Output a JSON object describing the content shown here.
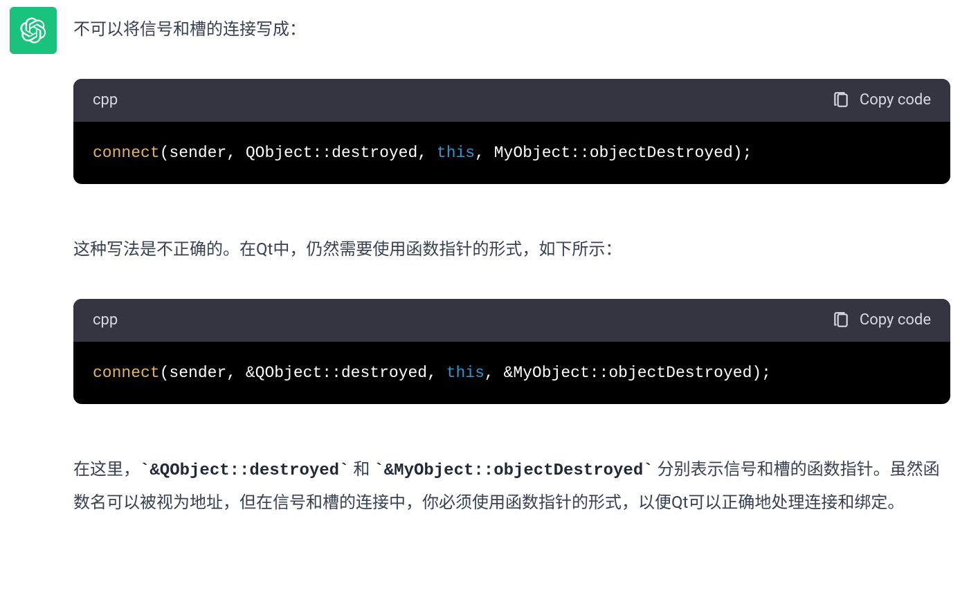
{
  "intro_text": "不可以将信号和槽的连接写成：",
  "code_blocks": [
    {
      "lang": "cpp",
      "copy_label": "Copy code",
      "tokens": {
        "func": "connect",
        "open": "(sender, QObject::destroyed, ",
        "kw": "this",
        "close": ", MyObject::objectDestroyed);"
      }
    },
    {
      "lang": "cpp",
      "copy_label": "Copy code",
      "tokens": {
        "func": "connect",
        "open": "(sender, &QObject::destroyed, ",
        "kw": "this",
        "close": ", &MyObject::objectDestroyed);"
      }
    }
  ],
  "middle_text": "这种写法是不正确的。在Qt中，仍然需要使用函数指针的形式，如下所示：",
  "final_para": {
    "t1": "在这里，",
    "code1": "`&QObject::destroyed`",
    "t2": " 和 ",
    "code2": "`&MyObject::objectDestroyed`",
    "t3": " 分别表示信号和槽的函数指针。虽然函数名可以被视为地址，但在信号和槽的连接中，你必须使用函数指针的形式，以便Qt可以正确地处理连接和绑定。"
  }
}
